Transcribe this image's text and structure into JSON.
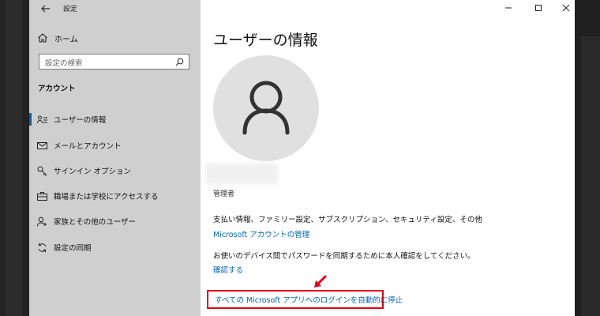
{
  "window": {
    "title": "設定"
  },
  "sidebar": {
    "home_label": "ホーム",
    "search_placeholder": "設定の検索",
    "section_label": "アカウント",
    "items": [
      {
        "label": "ユーザーの情報",
        "icon": "user-info-icon",
        "active": true
      },
      {
        "label": "メールとアカウント",
        "icon": "mail-icon",
        "active": false
      },
      {
        "label": "サインイン オプション",
        "icon": "key-icon",
        "active": false
      },
      {
        "label": "職場または学校にアクセスする",
        "icon": "briefcase-icon",
        "active": false
      },
      {
        "label": "家族とその他のユーザー",
        "icon": "add-user-icon",
        "active": false
      },
      {
        "label": "設定の同期",
        "icon": "sync-icon",
        "active": false
      }
    ]
  },
  "main": {
    "title": "ユーザーの情報",
    "role": "管理者",
    "billing_text": "支払い情報、ファミリー設定、サブスクリプション、セキュリティ設定、その他",
    "manage_link": "Microsoft アカウントの管理",
    "verify_text": "お使いのデバイス間でパスワードを同期するために本人確認をしてください。",
    "verify_link": "確認する",
    "stop_link": "すべての Microsoft アプリへのログインを自動的に停止"
  },
  "colors": {
    "accent": "#0063b1",
    "highlight": "#e60012",
    "sidebar_bg": "#cfcfcf"
  }
}
